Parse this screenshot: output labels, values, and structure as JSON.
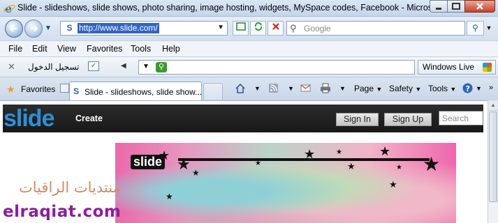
{
  "window": {
    "title": "Slide - slideshows, slide shows, photo sharing, image hosting, widgets, MySpace codes, Facebook - Micros..."
  },
  "address_bar": {
    "url": "http://www.slide.com/",
    "search_placeholder": "Google"
  },
  "menu": {
    "items": [
      "File",
      "Edit",
      "View",
      "Favorites",
      "Tools",
      "Help"
    ]
  },
  "toolbar": {
    "arabic_login": "تسجيل الدخول",
    "windows_live": "Windows Live"
  },
  "tabs": {
    "favorites_label": "Favorites",
    "active_tab": "Slide - slideshows, slide show...",
    "commands": {
      "page": "Page",
      "safety": "Safety",
      "tools": "Tools"
    }
  },
  "page": {
    "logo": "slide",
    "create": "Create",
    "sign_in": "Sign In",
    "sign_up": "Sign Up",
    "search_placeholder": "Search",
    "banner_logo": "slide",
    "watermark_arabic": "منتديات الراقيات",
    "watermark_english": "elraqiat.com"
  },
  "colors": {
    "slide_blue": "#2f8ed3",
    "watermark_purple": "#8b1e9e",
    "url_highlight": "#3163c5"
  }
}
